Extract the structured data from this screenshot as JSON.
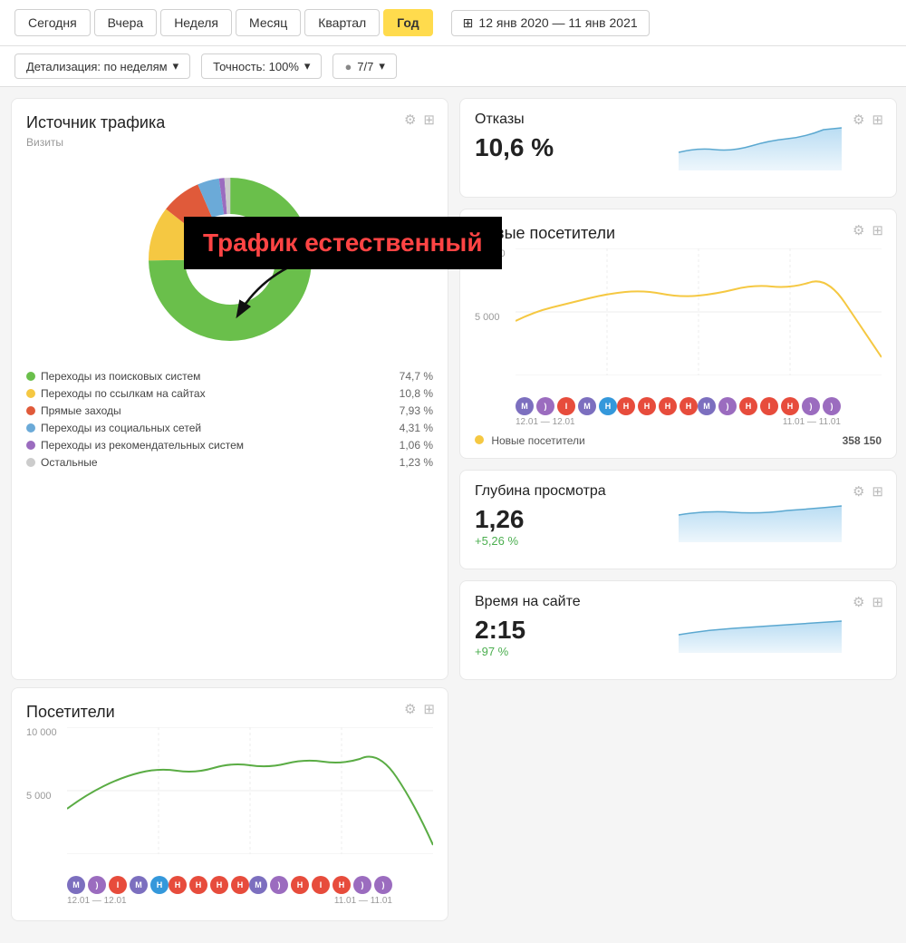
{
  "tabs": [
    {
      "label": "Сегодня",
      "active": false
    },
    {
      "label": "Вчера",
      "active": false
    },
    {
      "label": "Неделя",
      "active": false
    },
    {
      "label": "Месяц",
      "active": false
    },
    {
      "label": "Квартал",
      "active": false
    },
    {
      "label": "Год",
      "active": true
    }
  ],
  "date_range": "12 янв 2020 — 11 янв 2021",
  "filters": {
    "detail": "Детализация: по неделям",
    "accuracy": "Точность: 100%",
    "segments": "7/7"
  },
  "traffic_card": {
    "title": "Источник трафика",
    "subtitle": "Визиты",
    "legend": [
      {
        "label": "Переходы из поисковых систем",
        "pct": "74,7 %",
        "color": "#6abf4b"
      },
      {
        "label": "Переходы по ссылкам на сайтах",
        "pct": "10,8 %",
        "color": "#f5c842"
      },
      {
        "label": "Прямые заходы",
        "pct": "7,93 %",
        "color": "#e05a3a"
      },
      {
        "label": "Переходы из социальных сетей",
        "pct": "4,31 %",
        "color": "#6baad8"
      },
      {
        "label": "Переходы из рекомендательных систем",
        "pct": "1,06 %",
        "color": "#9b6cbf"
      },
      {
        "label": "Остальные",
        "pct": "1,23 %",
        "color": "#cccccc"
      }
    ]
  },
  "annotation": {
    "text": "Трафик естественный"
  },
  "bounce_card": {
    "title": "Отказы",
    "value": "10,6 %"
  },
  "new_visitors_card": {
    "title": "Новые посетители",
    "legend_label": "Новые посетители",
    "legend_value": "358 150",
    "y_labels": [
      "10 000",
      "5 000"
    ],
    "x_left": "12.01 — 12.01",
    "x_right": "11.01 — 11.01"
  },
  "visitors_card": {
    "title": "Посетители",
    "y_labels": [
      "10 000",
      "5 000"
    ],
    "x_left": "12.01 — 12.01",
    "x_right": "11.01 — 11.01"
  },
  "depth_card": {
    "title": "Глубина просмотра",
    "value": "1,26",
    "change": "+5,26 %"
  },
  "time_card": {
    "title": "Время на сайте",
    "value": "2:15",
    "change": "+97 %"
  }
}
